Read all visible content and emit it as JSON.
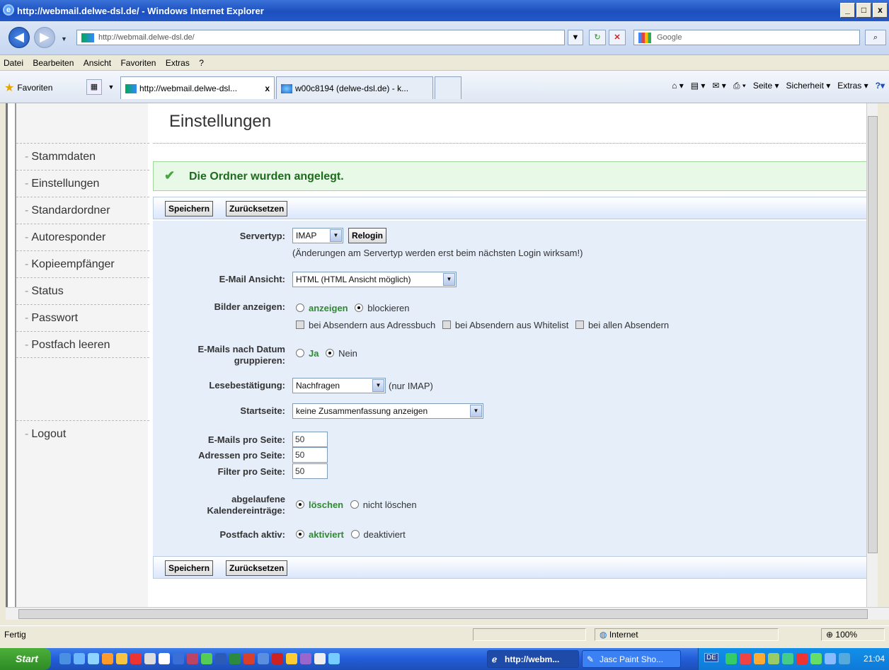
{
  "window": {
    "title": "http://webmail.delwe-dsl.de/ - Windows Internet Explorer",
    "controls": [
      "_",
      "□",
      "x"
    ]
  },
  "addressbar": {
    "url": "http://webmail.delwe-dsl.de/",
    "search_placeholder": "Google"
  },
  "menu": [
    "Datei",
    "Bearbeiten",
    "Ansicht",
    "Favoriten",
    "Extras",
    "?"
  ],
  "favbar": {
    "favorites_label": "Favoriten",
    "tabs": [
      {
        "label": "http://webmail.delwe-dsl...",
        "active": true,
        "close": "x"
      },
      {
        "label": "w00c8194 (delwe-dsl.de) - k...",
        "active": false
      }
    ],
    "commands": [
      "Seite ▾",
      "Sicherheit ▾",
      "Extras ▾"
    ]
  },
  "sidebar": {
    "items": [
      {
        "label": "Stammdaten"
      },
      {
        "label": "Einstellungen"
      },
      {
        "label": "Standardordner"
      },
      {
        "label": "Autoresponder"
      },
      {
        "label": "Kopieempfänger"
      },
      {
        "label": "Status"
      },
      {
        "label": "Passwort"
      },
      {
        "label": "Postfach leeren"
      },
      {
        "label": "Logout"
      }
    ],
    "dash": "-"
  },
  "page": {
    "title": "Einstellungen",
    "success_message": "Die Ordner wurden angelegt.",
    "save_label": "Speichern",
    "reset_label": "Zurücksetzen"
  },
  "form": {
    "servertyp": {
      "label": "Servertyp:",
      "value": "IMAP",
      "relogin_label": "Relogin",
      "hint": "(Änderungen am Servertyp werden erst beim nächsten Login wirksam!)"
    },
    "email_ansicht": {
      "label": "E-Mail Ansicht:",
      "value": "HTML (HTML Ansicht möglich)"
    },
    "bilder": {
      "label": "Bilder anzeigen:",
      "opt1": "anzeigen",
      "opt2": "blockieren",
      "selected": "blockieren",
      "chk1": "bei Absendern aus Adressbuch",
      "chk2": "bei Absendern aus Whitelist",
      "chk3": "bei allen Absendern"
    },
    "gruppieren": {
      "label_line1": "E-Mails nach Datum",
      "label_line2": "gruppieren:",
      "opt1": "Ja",
      "opt2": "Nein",
      "selected": "Nein"
    },
    "lesebestaetigung": {
      "label": "Lesebestätigung:",
      "value": "Nachfragen",
      "note": "(nur IMAP)"
    },
    "startseite": {
      "label": "Startseite:",
      "value": "keine Zusammenfassung anzeigen"
    },
    "emails_pro_seite": {
      "label": "E-Mails pro Seite:",
      "value": "50"
    },
    "adressen_pro_seite": {
      "label": "Adressen pro Seite:",
      "value": "50"
    },
    "filter_pro_seite": {
      "label": "Filter pro Seite:",
      "value": "50"
    },
    "kalender": {
      "label_line1": "abgelaufene",
      "label_line2": "Kalendereinträge:",
      "opt1": "löschen",
      "opt2": "nicht löschen",
      "selected": "löschen"
    },
    "postfach": {
      "label": "Postfach aktiv:",
      "opt1": "aktiviert",
      "opt2": "deaktiviert",
      "selected": "aktiviert"
    }
  },
  "statusbar": {
    "left": "Fertig",
    "zone": "Internet",
    "zoom": "100%"
  },
  "taskbar": {
    "start": "Start",
    "tasks": [
      {
        "label": "http://webm...",
        "active": true
      },
      {
        "label": "Jasc Paint Sho...",
        "active": false
      }
    ],
    "lang": "DE",
    "clock": "21:04"
  },
  "colors": {
    "success_bg": "#e9f9e8",
    "success_text": "#1d6b1d",
    "form_bg": "#e6eefa",
    "option_green": "#2f8a2f",
    "xp_blue": "#245edb"
  }
}
